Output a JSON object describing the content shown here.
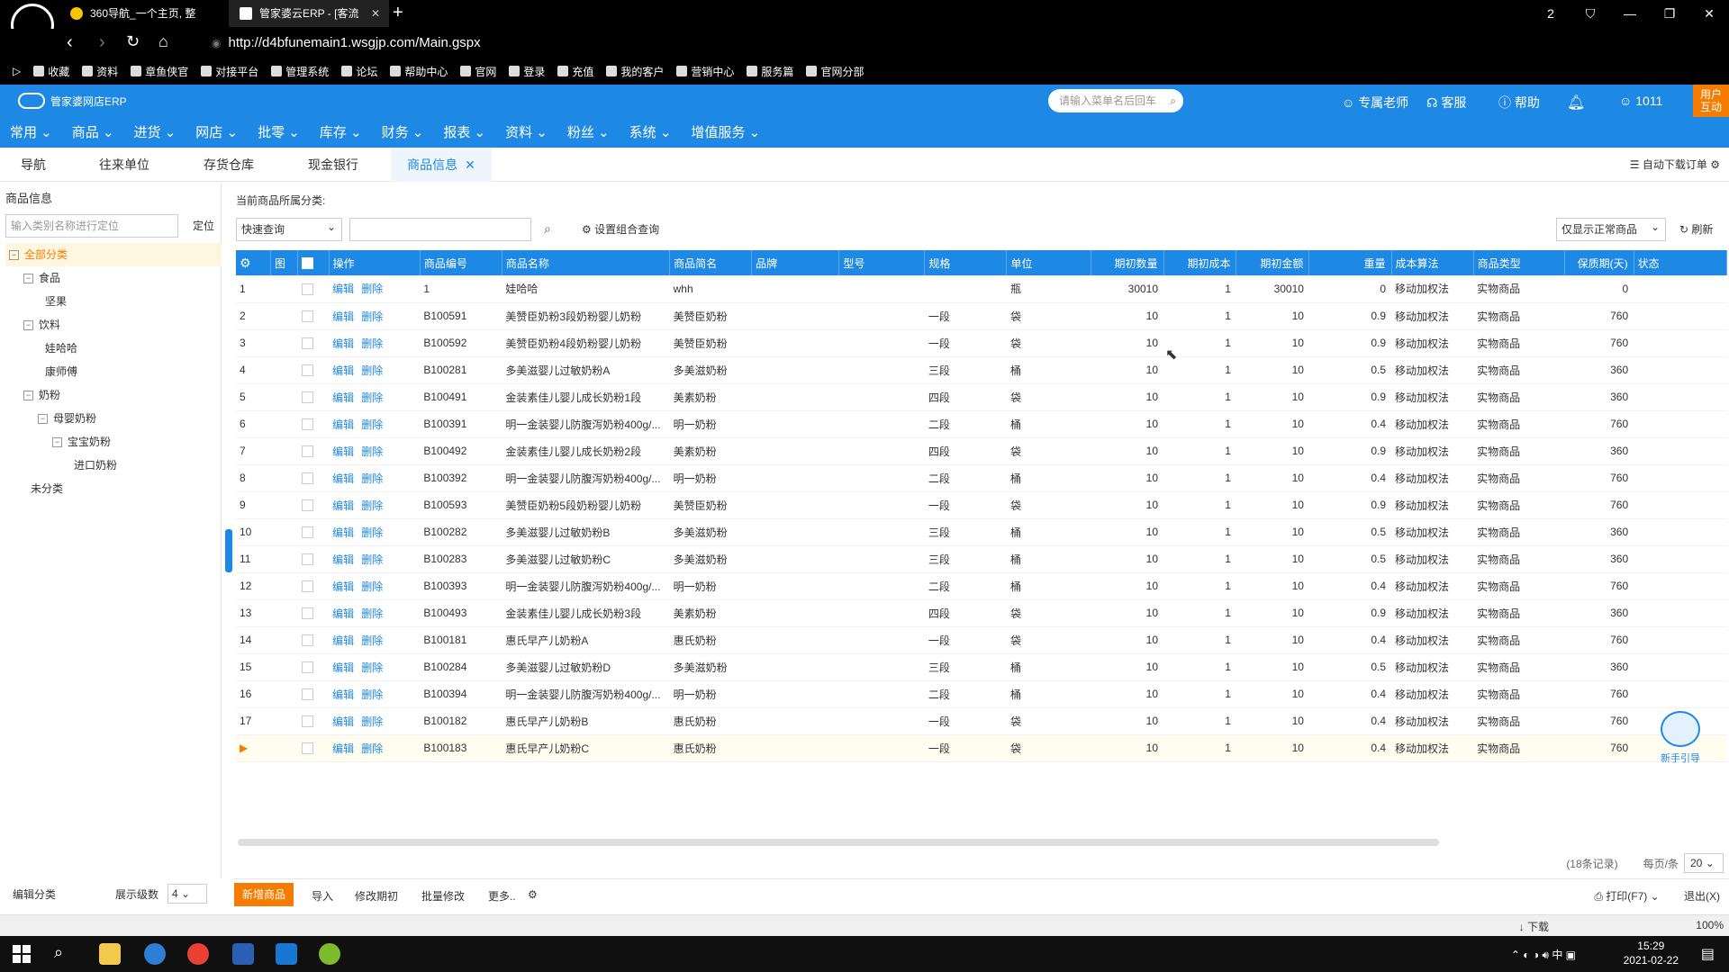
{
  "browser": {
    "tabs": [
      {
        "label": "360导航_一个主页, 整"
      },
      {
        "label": "管家婆云ERP - [客流"
      }
    ],
    "window_badge": "2",
    "url": "http://d4bfunemain1.wsgjp.com/Main.gspx",
    "bookmarks": [
      "收藏",
      "资料",
      "章鱼侠官",
      "对接平台",
      "管理系统",
      "论坛",
      "帮助中心",
      "官网",
      "登录",
      "充值",
      "我的客户",
      "营销中心",
      "服务篇",
      "官网分部"
    ]
  },
  "app": {
    "logo_text": "管家婆网店ERP",
    "search_placeholder": "请输入菜单名后回车",
    "header_links": {
      "teacher": "专属老师",
      "service": "客服",
      "help": "帮助",
      "user": "1011"
    },
    "user_box": {
      "line1": "用户",
      "line2": "互动"
    },
    "menu": [
      "常用",
      "商品",
      "进货",
      "网店",
      "批零",
      "库存",
      "财务",
      "报表",
      "资料",
      "粉丝",
      "系统",
      "增值服务"
    ]
  },
  "page_tabs": {
    "items": [
      "导航",
      "往来单位",
      "存货仓库",
      "现金银行",
      "商品信息"
    ],
    "right_label": "自动下载订单"
  },
  "left_panel": {
    "title": "商品信息",
    "search_placeholder": "输入类别名称进行定位",
    "locate_label": "定位",
    "tree": [
      {
        "label": "全部分类",
        "toggle": "⊟"
      },
      {
        "label": "食品",
        "toggle": "⊟"
      },
      {
        "label": "坚果",
        "toggle": ""
      },
      {
        "label": "饮料",
        "toggle": "⊟"
      },
      {
        "label": "娃哈哈",
        "toggle": ""
      },
      {
        "label": "康师傅",
        "toggle": ""
      },
      {
        "label": "奶粉",
        "toggle": "⊟"
      },
      {
        "label": "母婴奶粉",
        "toggle": "⊟"
      },
      {
        "label": "宝宝奶粉",
        "toggle": "⊟"
      },
      {
        "label": "进口奶粉",
        "toggle": ""
      },
      {
        "label": "未分类",
        "toggle": ""
      }
    ],
    "edit_category": "编辑分类",
    "level_label": "展示级数",
    "level_value": "4"
  },
  "toolbar": {
    "current_category_label": "当前商品所属分类:",
    "quick_query": "快速查询",
    "combo_query": "设置组合查询",
    "filter": "仅显示正常商品",
    "refresh": "刷新"
  },
  "grid": {
    "columns": [
      "",
      "图",
      "",
      "操作",
      "商品编号",
      "商品名称",
      "商品简名",
      "品牌",
      "型号",
      "规格",
      "单位",
      "期初数量",
      "期初成本",
      "期初金额",
      "重量",
      "成本算法",
      "商品类型",
      "保质期(天)",
      "状态"
    ],
    "edit_label": "编辑",
    "delete_label": "删除",
    "rows": [
      {
        "no": "1",
        "code": "1",
        "name": "娃哈哈",
        "short": "whh",
        "spec": "",
        "unit": "瓶",
        "qty": "30010",
        "cost": "1",
        "amount": "30010",
        "weight": "0",
        "method": "移动加权法",
        "type": "实物商品",
        "shelf": "0"
      },
      {
        "no": "2",
        "code": "B100591",
        "name": "美赞臣奶粉3段奶粉婴儿奶粉",
        "short": "美赞臣奶粉",
        "spec": "一段",
        "unit": "袋",
        "qty": "10",
        "cost": "1",
        "amount": "10",
        "weight": "0.9",
        "method": "移动加权法",
        "type": "实物商品",
        "shelf": "760"
      },
      {
        "no": "3",
        "code": "B100592",
        "name": "美赞臣奶粉4段奶粉婴儿奶粉",
        "short": "美赞臣奶粉",
        "spec": "一段",
        "unit": "袋",
        "qty": "10",
        "cost": "1",
        "amount": "10",
        "weight": "0.9",
        "method": "移动加权法",
        "type": "实物商品",
        "shelf": "760"
      },
      {
        "no": "4",
        "code": "B100281",
        "name": "多美滋婴儿过敏奶粉A",
        "short": "多美滋奶粉",
        "spec": "三段",
        "unit": "桶",
        "qty": "10",
        "cost": "1",
        "amount": "10",
        "weight": "0.5",
        "method": "移动加权法",
        "type": "实物商品",
        "shelf": "360"
      },
      {
        "no": "5",
        "code": "B100491",
        "name": "金装素佳儿婴儿成长奶粉1段",
        "short": "美素奶粉",
        "spec": "四段",
        "unit": "袋",
        "qty": "10",
        "cost": "1",
        "amount": "10",
        "weight": "0.9",
        "method": "移动加权法",
        "type": "实物商品",
        "shelf": "360"
      },
      {
        "no": "6",
        "code": "B100391",
        "name": "明一金装婴儿防腹泻奶粉400g/...",
        "short": "明一奶粉",
        "spec": "二段",
        "unit": "桶",
        "qty": "10",
        "cost": "1",
        "amount": "10",
        "weight": "0.4",
        "method": "移动加权法",
        "type": "实物商品",
        "shelf": "760"
      },
      {
        "no": "7",
        "code": "B100492",
        "name": "金装素佳儿婴儿成长奶粉2段",
        "short": "美素奶粉",
        "spec": "四段",
        "unit": "袋",
        "qty": "10",
        "cost": "1",
        "amount": "10",
        "weight": "0.9",
        "method": "移动加权法",
        "type": "实物商品",
        "shelf": "360"
      },
      {
        "no": "8",
        "code": "B100392",
        "name": "明一金装婴儿防腹泻奶粉400g/...",
        "short": "明一奶粉",
        "spec": "二段",
        "unit": "桶",
        "qty": "10",
        "cost": "1",
        "amount": "10",
        "weight": "0.4",
        "method": "移动加权法",
        "type": "实物商品",
        "shelf": "760"
      },
      {
        "no": "9",
        "code": "B100593",
        "name": "美赞臣奶粉5段奶粉婴儿奶粉",
        "short": "美赞臣奶粉",
        "spec": "一段",
        "unit": "袋",
        "qty": "10",
        "cost": "1",
        "amount": "10",
        "weight": "0.9",
        "method": "移动加权法",
        "type": "实物商品",
        "shelf": "760"
      },
      {
        "no": "10",
        "code": "B100282",
        "name": "多美滋婴儿过敏奶粉B",
        "short": "多美滋奶粉",
        "spec": "三段",
        "unit": "桶",
        "qty": "10",
        "cost": "1",
        "amount": "10",
        "weight": "0.5",
        "method": "移动加权法",
        "type": "实物商品",
        "shelf": "360"
      },
      {
        "no": "11",
        "code": "B100283",
        "name": "多美滋婴儿过敏奶粉C",
        "short": "多美滋奶粉",
        "spec": "三段",
        "unit": "桶",
        "qty": "10",
        "cost": "1",
        "amount": "10",
        "weight": "0.5",
        "method": "移动加权法",
        "type": "实物商品",
        "shelf": "360"
      },
      {
        "no": "12",
        "code": "B100393",
        "name": "明一金装婴儿防腹泻奶粉400g/...",
        "short": "明一奶粉",
        "spec": "二段",
        "unit": "桶",
        "qty": "10",
        "cost": "1",
        "amount": "10",
        "weight": "0.4",
        "method": "移动加权法",
        "type": "实物商品",
        "shelf": "760"
      },
      {
        "no": "13",
        "code": "B100493",
        "name": "金装素佳儿婴儿成长奶粉3段",
        "short": "美素奶粉",
        "spec": "四段",
        "unit": "袋",
        "qty": "10",
        "cost": "1",
        "amount": "10",
        "weight": "0.9",
        "method": "移动加权法",
        "type": "实物商品",
        "shelf": "360"
      },
      {
        "no": "14",
        "code": "B100181",
        "name": "惠氏早产儿奶粉A",
        "short": "惠氏奶粉",
        "spec": "一段",
        "unit": "袋",
        "qty": "10",
        "cost": "1",
        "amount": "10",
        "weight": "0.4",
        "method": "移动加权法",
        "type": "实物商品",
        "shelf": "760"
      },
      {
        "no": "15",
        "code": "B100284",
        "name": "多美滋婴儿过敏奶粉D",
        "short": "多美滋奶粉",
        "spec": "三段",
        "unit": "桶",
        "qty": "10",
        "cost": "1",
        "amount": "10",
        "weight": "0.5",
        "method": "移动加权法",
        "type": "实物商品",
        "shelf": "360"
      },
      {
        "no": "16",
        "code": "B100394",
        "name": "明一金装婴儿防腹泻奶粉400g/...",
        "short": "明一奶粉",
        "spec": "二段",
        "unit": "桶",
        "qty": "10",
        "cost": "1",
        "amount": "10",
        "weight": "0.4",
        "method": "移动加权法",
        "type": "实物商品",
        "shelf": "760"
      },
      {
        "no": "17",
        "code": "B100182",
        "name": "惠氏早产儿奶粉B",
        "short": "惠氏奶粉",
        "spec": "一段",
        "unit": "袋",
        "qty": "10",
        "cost": "1",
        "amount": "10",
        "weight": "0.4",
        "method": "移动加权法",
        "type": "实物商品",
        "shelf": "760"
      },
      {
        "no": "▶",
        "code": "B100183",
        "name": "惠氏早产儿奶粉C",
        "short": "惠氏奶粉",
        "spec": "一段",
        "unit": "袋",
        "qty": "10",
        "cost": "1",
        "amount": "10",
        "weight": "0.4",
        "method": "移动加权法",
        "type": "实物商品",
        "shelf": "760"
      }
    ]
  },
  "pager": {
    "total": "(18条记录)",
    "per_page_label": "每页/条",
    "per_page": "20"
  },
  "bottom": {
    "add": "新增商品",
    "import": "导入",
    "modify_initial": "修改期初",
    "batch_modify": "批量修改",
    "more": "更多..",
    "print": "打印(F7)",
    "exit": "退出(X)"
  },
  "helper_label": "新手引导",
  "status": {
    "download": "下载",
    "zoom": "100%"
  },
  "taskbar": {
    "time": "15:29",
    "date": "2021-02-22",
    "ime": "中"
  },
  "colors": {
    "brand": "#1e88e5",
    "accent": "#f57c00"
  }
}
